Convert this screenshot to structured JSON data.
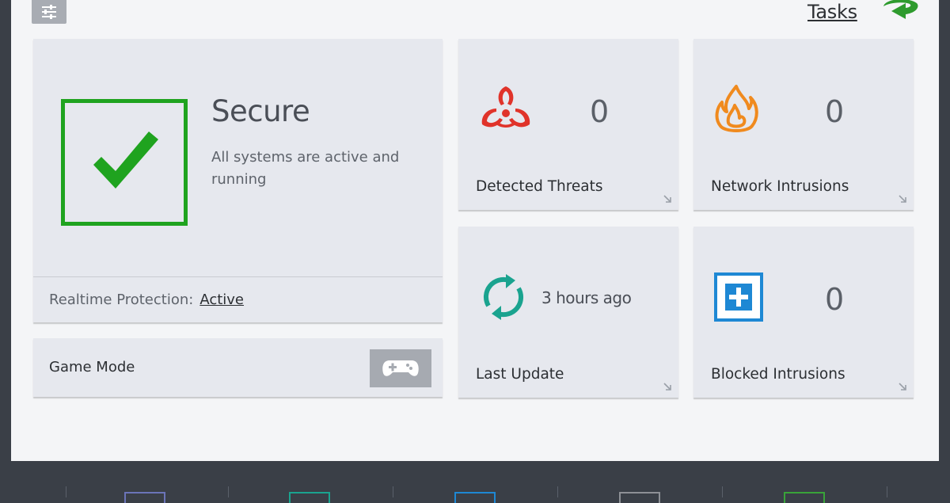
{
  "header": {
    "settings_icon": "sliders-icon",
    "tasks_label": "Tasks",
    "tasks_icon": "curved-arrow-icon"
  },
  "status": {
    "title": "Secure",
    "description": "All systems are active and running",
    "icon": "checkmark-icon",
    "realtime_label": "Realtime Protection:",
    "realtime_value": "Active"
  },
  "game_mode": {
    "label": "Game Mode",
    "icon": "gamepad-icon"
  },
  "tiles": [
    {
      "label": "Detected Threats",
      "value": "0",
      "icon": "biohazard-icon",
      "color": "#e0332a"
    },
    {
      "label": "Network Intrusions",
      "value": "0",
      "icon": "flame-icon",
      "color": "#f08a1e"
    },
    {
      "label": "Last Update",
      "value": "3 hours ago",
      "icon": "refresh-icon",
      "color": "#1aa38f"
    },
    {
      "label": "Blocked Intrusions",
      "value": "0",
      "icon": "plus-box-icon",
      "color": "#1e88d4"
    }
  ],
  "colors": {
    "secure_green": "#1fa31f",
    "tasks_green": "#2e9b2e",
    "taskbar_icons": [
      "#6b74b8",
      "#1aa38f",
      "#1e88d4",
      "#8d9096",
      "#39a339"
    ]
  }
}
